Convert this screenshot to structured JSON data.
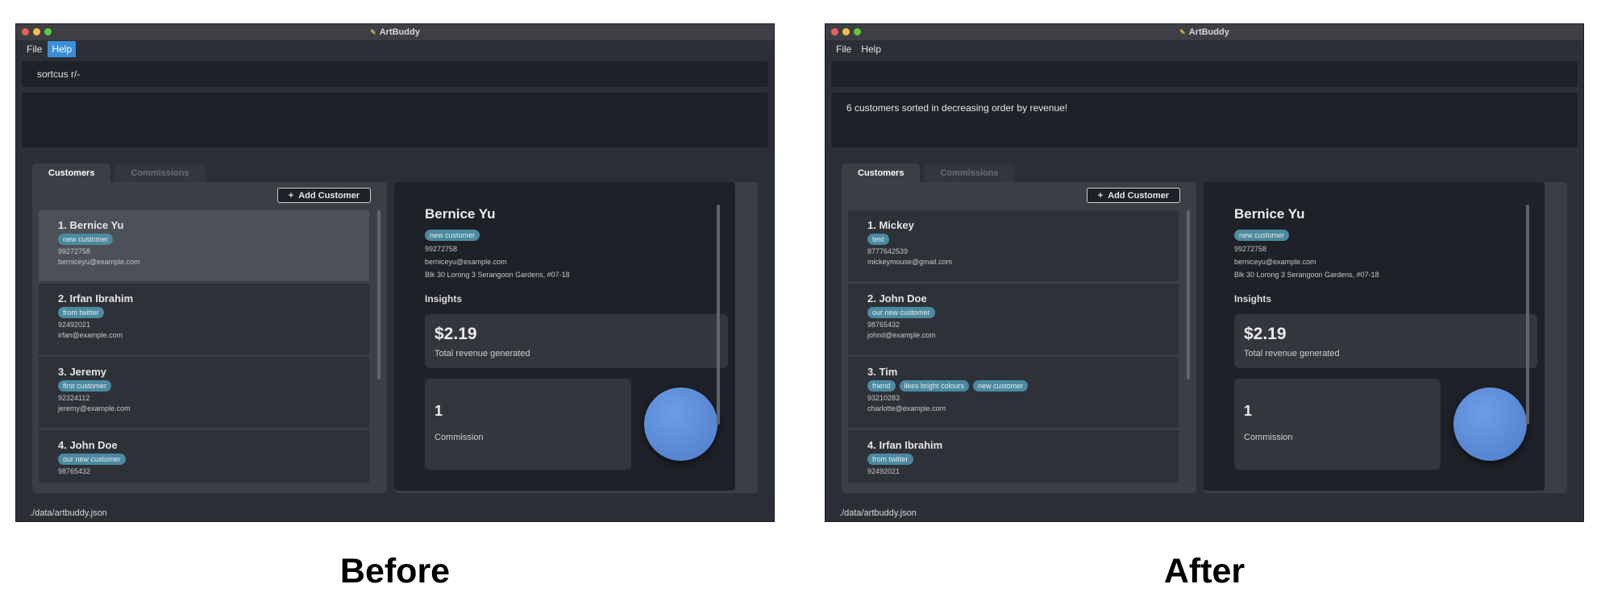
{
  "app_title": "ArtBuddy",
  "menu": [
    "File",
    "Help"
  ],
  "tabs": [
    "Customers",
    "Commissions"
  ],
  "add_button": "Add Customer",
  "add_icon": "+",
  "insights_label": "Insights",
  "revenue_label": "Total revenue generated",
  "commission_label": "Commission",
  "status_path": "./data/artbuddy.json",
  "before": {
    "caption": "Before",
    "command": "sortcus r/-",
    "result": "",
    "customers": [
      {
        "name": "1.  Bernice Yu",
        "tags": [
          "new customer"
        ],
        "phone": "99272758",
        "email": "berniceyu@example.com"
      },
      {
        "name": "2.  Irfan Ibrahim",
        "tags": [
          "from twitter"
        ],
        "phone": "92492021",
        "email": "irfan@example.com"
      },
      {
        "name": "3.  Jeremy",
        "tags": [
          "first customer"
        ],
        "phone": "92324112",
        "email": "jeremy@example.com"
      },
      {
        "name": "4.  John Doe",
        "tags": [
          "our new customer"
        ],
        "phone": "98765432",
        "email": ""
      }
    ],
    "detail": {
      "name": "Bernice Yu",
      "tag": "new customer",
      "phone": "99272758",
      "email": "berniceyu@example.com",
      "address": "Blk 30 Lorong 3 Serangoon Gardens, #07-18",
      "revenue": "$2.19",
      "commissions": "1"
    }
  },
  "after": {
    "caption": "After",
    "command": "",
    "result": "6 customers sorted in decreasing order by revenue!",
    "customers": [
      {
        "name": "1.  Mickey",
        "tags": [
          "test"
        ],
        "phone": "8777642539",
        "email": "mickeymouse@gmail.com"
      },
      {
        "name": "2.  John Doe",
        "tags": [
          "our new customer"
        ],
        "phone": "98765432",
        "email": "johnd@example.com"
      },
      {
        "name": "3.  Tim",
        "tags": [
          "friend",
          "likes bright colours",
          "new customer"
        ],
        "phone": "93210283",
        "email": "charlotte@example.com"
      },
      {
        "name": "4.  Irfan Ibrahim",
        "tags": [
          "from twitter"
        ],
        "phone": "92492021",
        "email": ""
      }
    ],
    "detail": {
      "name": "Bernice Yu",
      "tag": "new customer",
      "phone": "99272758",
      "email": "berniceyu@example.com",
      "address": "Blk 30 Lorong 3 Serangoon Gardens, #07-18",
      "revenue": "$2.19",
      "commissions": "1"
    }
  }
}
